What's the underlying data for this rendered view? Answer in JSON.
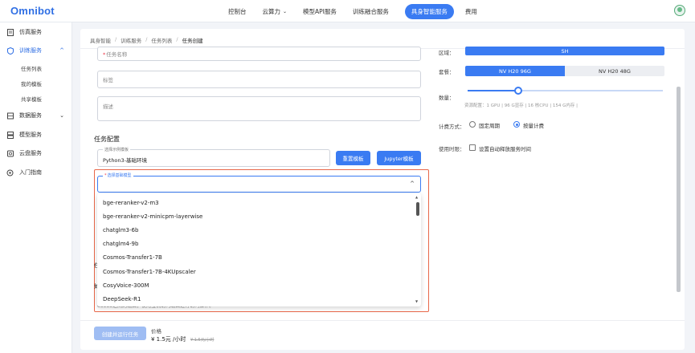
{
  "app": {
    "logo": "Omnibot"
  },
  "nav": {
    "items": [
      {
        "label": "控制台",
        "active": false
      },
      {
        "label": "云算力",
        "caret": "⌄",
        "active": false
      },
      {
        "label": "模型API服务",
        "active": false
      },
      {
        "label": "训练融合服务",
        "active": false
      },
      {
        "label": "具身智能服务",
        "active": true
      },
      {
        "label": "费用",
        "active": false
      }
    ]
  },
  "sidebar": {
    "items": [
      {
        "label": "仿真服务",
        "icon": "document-icon"
      },
      {
        "label": "训练服务",
        "icon": "shield-icon",
        "chevron": "^",
        "active": true
      },
      {
        "label": "数据服务",
        "icon": "grid-icon",
        "chevron": "⌄"
      },
      {
        "label": "模型服务",
        "icon": "server-icon"
      },
      {
        "label": "云盘服务",
        "icon": "disk-icon"
      },
      {
        "label": "入门指南",
        "icon": "gear-icon"
      }
    ],
    "subitems": [
      "任务列表",
      "我的模板",
      "共享模板"
    ]
  },
  "breadcrumb": [
    "具身智能",
    "训练服务",
    "任务列表",
    "任务创建"
  ],
  "form": {
    "task_name_placeholder": "任务名称",
    "tag_placeholder": "标签",
    "desc_placeholder": "描述",
    "section_title": "任务配置",
    "template_label": "选择示例模板",
    "template_value": "Python3-基础环境",
    "reset_button": "重置模板",
    "jupyter_button": "Jupyter模板",
    "base_model_label": "选择基础模型",
    "base_model_chevron": "^",
    "dropdown_options": [
      "bge-reranker-v2-m3",
      "bge-reranker-v2-minicpm-layerwise",
      "chatglm3-6b",
      "chatglm4-9b",
      "Cosmos-Transfer1-7B",
      "Cosmos-Transfer1-7B-4KUpscaler",
      "CosyVoice-300M",
      "DeepSeek-R1"
    ],
    "peek_char_1": "任",
    "peek_char_2": "如",
    "hint_text": "65535之间的端口，使用宝机访问端口进行访问操作。"
  },
  "config": {
    "region_label": "区域：",
    "region_value": "SH",
    "package_label": "套餐：",
    "package_selected": "NV H20 96G",
    "package_other": "NV H20 48G",
    "quantity_label": "数量：",
    "quantity_fraction": 0.26,
    "resource_info": "资源配置：1 GPU | 96 G显存 | 16 核CPU | 154 G内存 |",
    "billing_label": "计费方式：",
    "billing_fixed": "固定周期",
    "billing_usage": "按量计费",
    "time_label": "使用时限：",
    "auto_release": "设置自动释放服务时间"
  },
  "footer": {
    "submit_button": "创建并运行任务",
    "price_label": "价格",
    "price_value": "¥ 1.5元 /小时",
    "price_old": "¥ 1.5元/小时"
  },
  "colors": {
    "primary": "#3a7bf2",
    "error_border": "#e8684a",
    "disabled_button": "#9fbdf3"
  }
}
